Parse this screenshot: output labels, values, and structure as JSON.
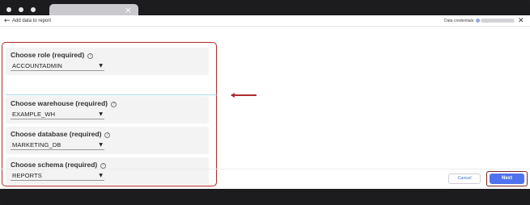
{
  "header": {
    "back_icon": "arrow-left-icon",
    "title": "Add data to report",
    "credentials_label": "Data credentials:",
    "close_icon": "close-icon"
  },
  "form": {
    "sections": [
      {
        "label": "Choose role (required)",
        "value": "ACCOUNTADMIN"
      },
      {
        "label": "Choose warehouse (required)",
        "value": "EXAMPLE_WH"
      },
      {
        "label": "Choose database (required)",
        "value": "MARKETING_DB"
      },
      {
        "label": "Choose schema (required)",
        "value": "REPORTS"
      }
    ],
    "help_glyph": "?",
    "caret_glyph": "▼"
  },
  "footer": {
    "cancel_label": "Cancel",
    "next_label": "Next"
  },
  "colors": {
    "highlight_border": "#b02b2b",
    "primary_button": "#4f72ef",
    "cancel_text": "#3a6fd8"
  }
}
